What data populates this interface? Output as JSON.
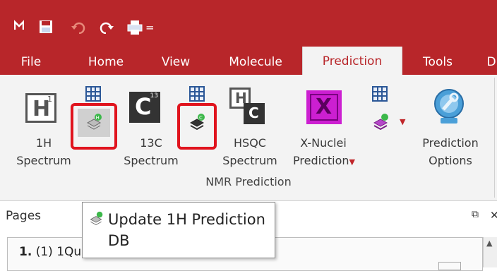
{
  "qat": {
    "menu_arrow": "="
  },
  "tabs": [
    {
      "label": "File"
    },
    {
      "label": "Home"
    },
    {
      "label": "View"
    },
    {
      "label": "Molecule"
    },
    {
      "label": "Prediction"
    },
    {
      "label": "Tools"
    },
    {
      "label": "D"
    }
  ],
  "ribbon": {
    "buttons": {
      "h1_icon_letter": "H",
      "h1_icon_sup": "1",
      "h1_label_line1": "1H",
      "h1_label_line2": "Spectrum",
      "c13_icon_letter": "C",
      "c13_icon_sup": "13",
      "c13_label_line1": "13C",
      "c13_label_line2": "Spectrum",
      "hsqc_icon_h": "H",
      "hsqc_icon_c": "C",
      "hsqc_label_line1": "HSQC",
      "hsqc_label_line2": "Spectrum",
      "xnuclei_icon_letter": "X",
      "xnuclei_label_line1": "X-Nuclei",
      "xnuclei_label_line2": "Prediction",
      "options_label_line1": "Prediction",
      "options_label_line2": "Options"
    },
    "group_label": "NMR Prediction"
  },
  "pages": {
    "header": "Pages",
    "item_number": "1.",
    "item_title": "(1) 1Qu..."
  },
  "tooltip": {
    "line1": "Update 1H Prediction",
    "line2": "DB"
  },
  "colors": {
    "accent": "#b8262a",
    "highlight": "#e0141e"
  }
}
